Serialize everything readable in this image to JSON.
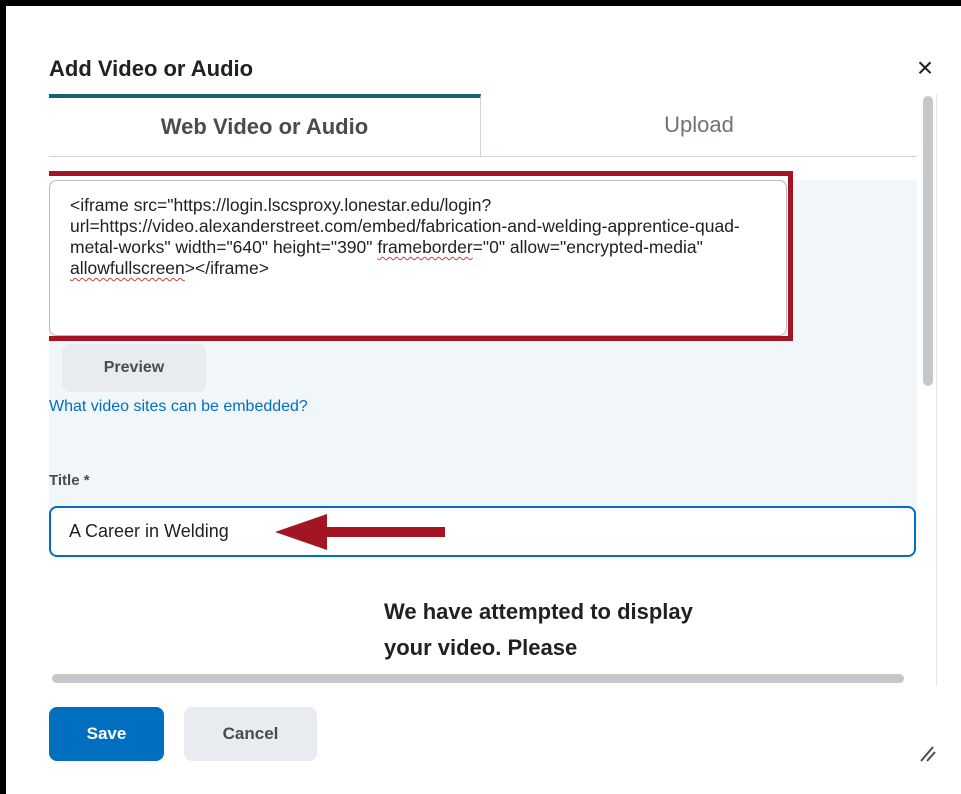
{
  "dialog": {
    "title": "Add Video or Audio",
    "close_symbol": "×"
  },
  "tabs": [
    {
      "label": "Web Video or Audio",
      "active": true
    },
    {
      "label": "Upload",
      "active": false
    }
  ],
  "embed": {
    "code_parts": [
      "<iframe src=\"https://login.lscsproxy.lonestar.edu/login?url=https://video.alexanderstreet.com/embed/fabrication-and-welding-apprentice-quad-metal-works\" width=\"640\" height=\"390\" ",
      "frameborder",
      "=\"0\" allow=\"encrypted-media\" ",
      "allowfullscreen",
      "></iframe>"
    ],
    "preview_label": "Preview",
    "sites_link": "What video sites can be embedded?"
  },
  "title_field": {
    "label": "Title *",
    "value": "A Career in Welding"
  },
  "message": "We have attempted to display your video. Please",
  "footer": {
    "save_label": "Save",
    "cancel_label": "Cancel"
  },
  "colors": {
    "accent": "#006fbf",
    "highlight": "#a31522",
    "tab_indicator": "#0f6478",
    "panel_bg": "#f1f6fb"
  },
  "icons": {
    "close": "close-icon",
    "resize": "resize-handle-icon",
    "arrow": "arrow-left-annotation"
  }
}
